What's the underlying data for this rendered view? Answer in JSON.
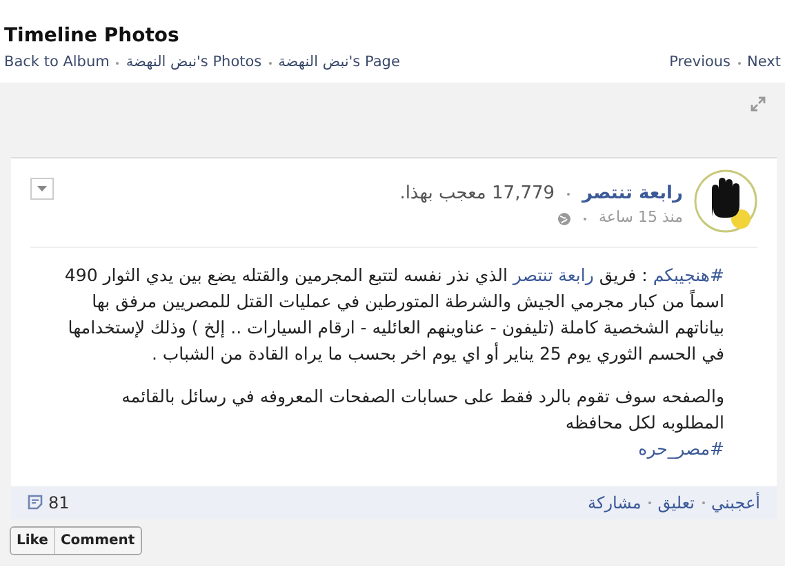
{
  "header": {
    "title": "Timeline Photos",
    "back_link": "Back to Album",
    "photos_link": "نبض النهضة's Photos",
    "page_link": "نبض النهضة's Page",
    "previous_link": "Previous",
    "next_link": "Next"
  },
  "post": {
    "page_name": "رابعة تنتصر",
    "likes": "17,779 معجب بهذا.",
    "time": "منذ 15 ساعة",
    "paragraphs": [
      [
        {
          "kind": "link",
          "text": "#هنجيبكم"
        },
        {
          "kind": "plain",
          "text": " : فريق "
        },
        {
          "kind": "link",
          "text": "رابعة تنتصر"
        },
        {
          "kind": "plain",
          "text": " الذي نذر نفسه لتتبع المجرمين والقتله يضع بين يدي الثوار 490 اسماً من كبار مجرمي الجيش والشرطة المتورطين في عمليات القتل للمصريين مرفق بها بياناتهم الشخصية كاملة (تليفون - عناوينهم العائليه - ارقام السيارات .. إلخ ) وذلك لإستخدامها في الحسم الثوري يوم 25 يناير أو اي يوم اخر بحسب ما يراه القادة من الشباب ."
        }
      ],
      [
        {
          "kind": "plain",
          "text": "والصفحه سوف تقوم بالرد فقط على حسابات الصفحات المعروفه في رسائل بالقائمه المطلوبه لكل محافظه"
        },
        {
          "kind": "break"
        },
        {
          "kind": "link",
          "text": "#مصر_حره"
        }
      ]
    ],
    "actions": [
      "أعجبني",
      "تعليق",
      "مشاركة"
    ],
    "comment_count": "81"
  },
  "like_button": "Like",
  "comment_button": "Comment"
}
